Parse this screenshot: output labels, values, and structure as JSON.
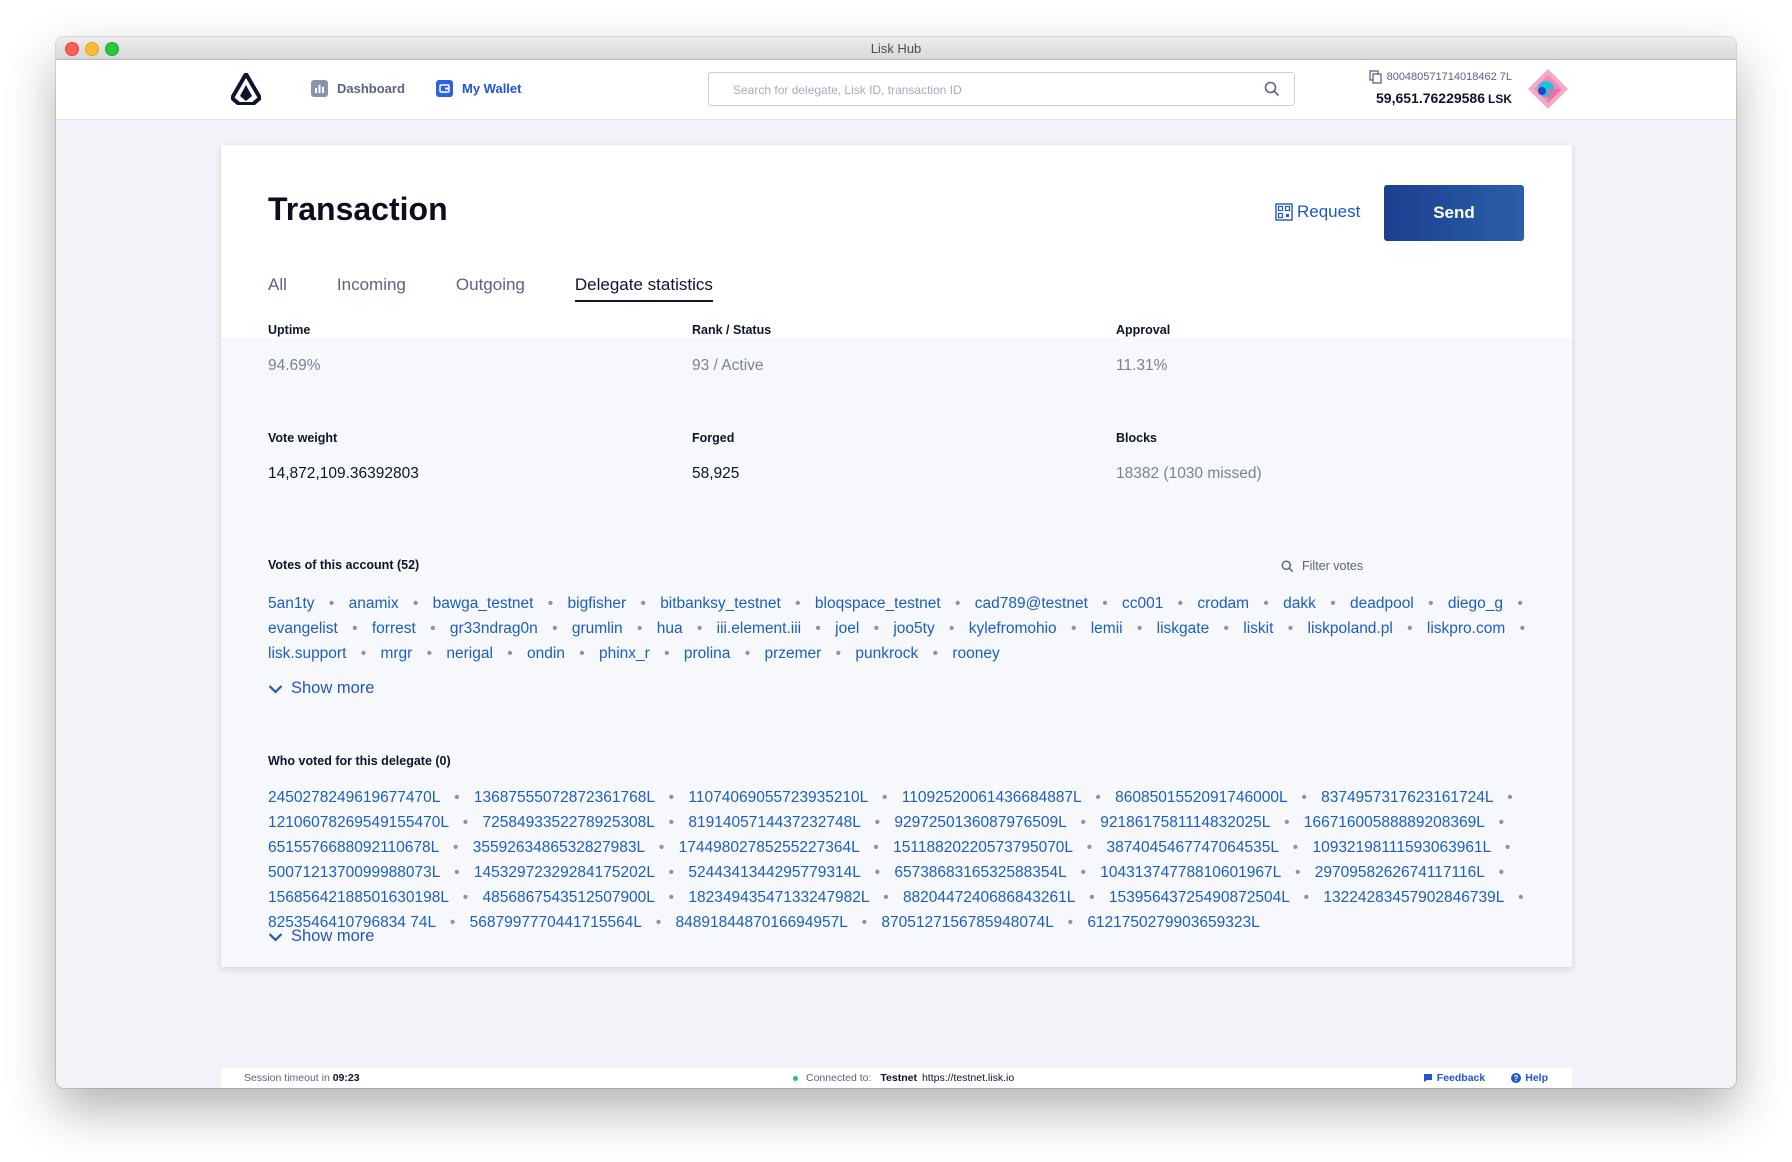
{
  "window": {
    "title": "Lisk Hub"
  },
  "nav": {
    "dashboard": "Dashboard",
    "wallet": "My Wallet"
  },
  "search": {
    "placeholder": "Search for delegate, Lisk ID, transaction ID"
  },
  "account": {
    "address": "800480571714018462 7L",
    "balance": "59,651.76229586",
    "unit": "LSK"
  },
  "page": {
    "title": "Transaction",
    "request_label": "Request",
    "send_label": "Send",
    "tabs": [
      "All",
      "Incoming",
      "Outgoing",
      "Delegate statistics"
    ],
    "active_tab": "Delegate statistics"
  },
  "stats": {
    "uptime": {
      "label": "Uptime",
      "value": "94.69%"
    },
    "rank": {
      "label": "Rank / Status",
      "value": "93 / Active"
    },
    "approval": {
      "label": "Approval",
      "value": "11.31%"
    },
    "vote_weight": {
      "label": "Vote weight",
      "value": "14,872,109.36392803"
    },
    "forged": {
      "label": "Forged",
      "value": "58,925"
    },
    "blocks": {
      "label": "Blocks",
      "value": "18382 (1030 missed)"
    }
  },
  "votes": {
    "label": "Votes of this account (52)",
    "filter_placeholder": "Filter votes",
    "items": [
      "5an1ty",
      "anamix",
      "bawga_testnet",
      "bigfisher",
      "bitbanksy_testnet",
      "bloqspace_testnet",
      "cad789@testnet",
      "cc001",
      "crodam",
      "dakk",
      "deadpool",
      "diego_g",
      "evangelist",
      "forrest",
      "gr33ndrag0n",
      "grumlin",
      "hua",
      "iii.element.iii",
      "joel",
      "joo5ty",
      "kylefromohio",
      "lemii",
      "liskgate",
      "liskit",
      "liskpoland.pl",
      "liskpro.com",
      "lisk.support",
      "mrgr",
      "nerigal",
      "ondin",
      "phinx_r",
      "prolina",
      "przemer",
      "punkrock",
      "rooney"
    ],
    "show_more": "Show more"
  },
  "voters": {
    "label": "Who voted for this delegate (0)",
    "items": [
      "2450278249619677470L",
      "13687555072872361768L",
      "11074069055723935210L",
      "11092520061436684887L",
      "8608501552091746000L",
      "8374957317623161724L",
      "12106078269549155470L",
      "7258493352278925308L",
      "8191405714437232748L",
      "9297250136087976509L",
      "9218617581114832025L",
      "16671600588889208369L",
      "6515576688092110678L",
      "3559263486532827983L",
      "17449802785255227364L",
      "15118820220573795070L",
      "3874045467747064535L",
      "10932198111593063961L",
      "5007121370099988073L",
      "14532972329284175202L",
      "5244341344295779314L",
      "6573868316532588354L",
      "10431374778810601967L",
      "2970958262674117116L",
      "15685642188501630198L",
      "4856867543512507900L",
      "18234943547133247982L",
      "8820447240686843261L",
      "15395643725490872504L",
      "13224283457902846739L",
      "8253546410796834 74L",
      "5687997770441715564L",
      "8489184487016694957L",
      "8705127156785948074L",
      "6121750279903659323L"
    ],
    "show_more": "Show more"
  },
  "footer": {
    "session_label": "Session timeout in",
    "session_time": "09:23",
    "connected_label": "Connected to:",
    "network": "Testnet",
    "url": "https://testnet.lisk.io",
    "feedback": "Feedback",
    "help": "Help"
  },
  "colors": {
    "accent": "#2057b8",
    "send_button": "#1c3f8f",
    "link": "#1a5fbf",
    "status_online": "#2ac06b"
  }
}
